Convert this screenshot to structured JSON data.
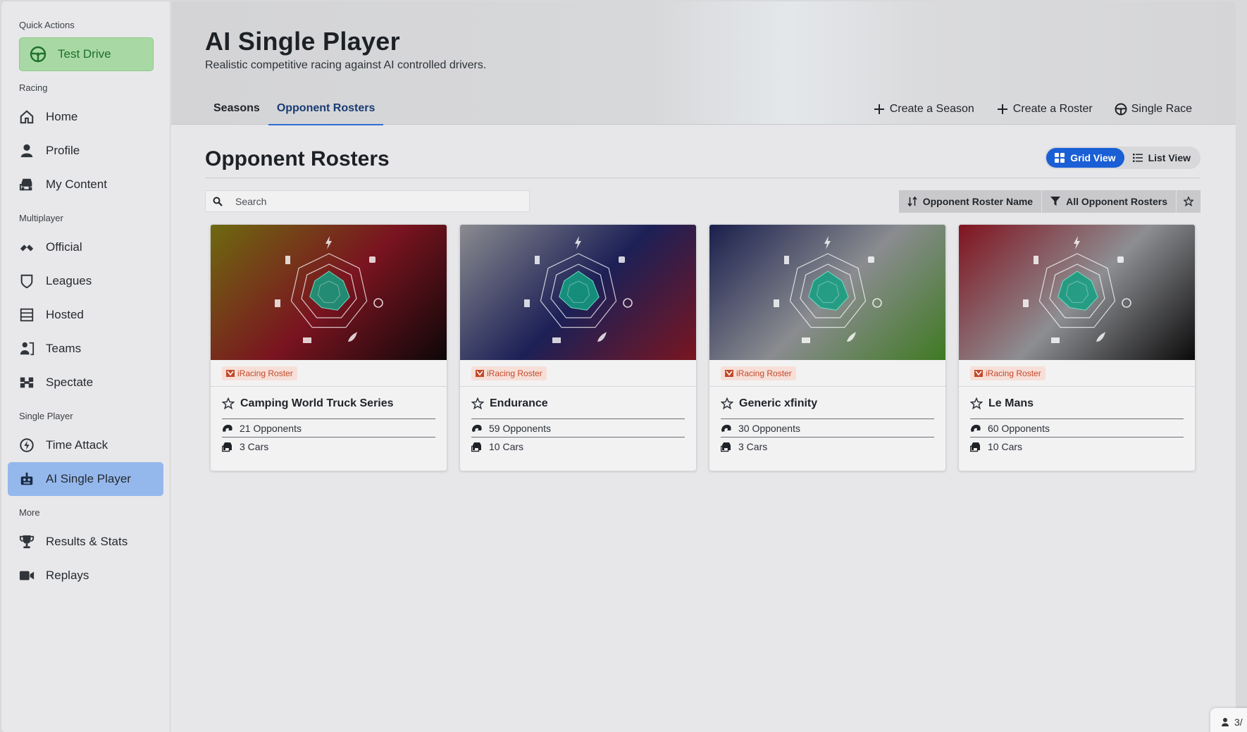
{
  "sidebar": {
    "sections": [
      {
        "title": "Quick Actions"
      },
      {
        "title": "Racing"
      },
      {
        "title": "Multiplayer"
      },
      {
        "title": "Single Player"
      },
      {
        "title": "More"
      }
    ],
    "test_drive": "Test Drive",
    "items": [
      {
        "label": "Home",
        "icon": "home-icon"
      },
      {
        "label": "Profile",
        "icon": "profile-icon"
      },
      {
        "label": "My Content",
        "icon": "my-content-icon"
      },
      {
        "label": "Official",
        "icon": "official-icon"
      },
      {
        "label": "Leagues",
        "icon": "leagues-icon"
      },
      {
        "label": "Hosted",
        "icon": "hosted-icon"
      },
      {
        "label": "Teams",
        "icon": "teams-icon"
      },
      {
        "label": "Spectate",
        "icon": "spectate-icon"
      },
      {
        "label": "Time Attack",
        "icon": "time-attack-icon"
      },
      {
        "label": "AI Single Player",
        "icon": "robot-icon",
        "active": true
      },
      {
        "label": "Results & Stats",
        "icon": "trophy-icon"
      },
      {
        "label": "Replays",
        "icon": "video-icon"
      }
    ]
  },
  "header": {
    "title": "AI Single Player",
    "subtitle": "Realistic competitive racing against AI controlled drivers.",
    "tabs": [
      {
        "label": "Seasons",
        "active": false
      },
      {
        "label": "Opponent Rosters",
        "active": true
      }
    ],
    "actions": [
      {
        "label": "Create a Season",
        "icon": "plus-icon"
      },
      {
        "label": "Create a Roster",
        "icon": "plus-icon"
      },
      {
        "label": "Single Race",
        "icon": "steering-wheel-icon"
      }
    ]
  },
  "content": {
    "title": "Opponent Rosters",
    "view_toggle": {
      "grid": "Grid View",
      "list": "List View",
      "active": "grid"
    },
    "search_placeholder": "Search",
    "sort_label": "Opponent Roster Name",
    "filter_label": "All Opponent Rosters"
  },
  "cards": [
    {
      "tag": "iRacing Roster",
      "name": "Camping World Truck Series",
      "opponents": "21 Opponents",
      "cars": "3 Cars",
      "colors": [
        "#6e6a10",
        "#7a1420",
        "#0d0708"
      ]
    },
    {
      "tag": "iRacing Roster",
      "name": "Endurance",
      "opponents": "59 Opponents",
      "cars": "10 Cars",
      "colors": [
        "#8a8b8f",
        "#1c2056",
        "#7a1520"
      ]
    },
    {
      "tag": "iRacing Roster",
      "name": "Generic xfinity",
      "opponents": "30 Opponents",
      "cars": "3 Cars",
      "colors": [
        "#1a1f4d",
        "#8a8c90",
        "#3f7a22"
      ]
    },
    {
      "tag": "iRacing Roster",
      "name": "Le Mans",
      "opponents": "60 Opponents",
      "cars": "10 Cars",
      "colors": [
        "#80131f",
        "#8d8e92",
        "#0a0a0a"
      ]
    }
  ],
  "corner_chip": {
    "label": "3/"
  }
}
